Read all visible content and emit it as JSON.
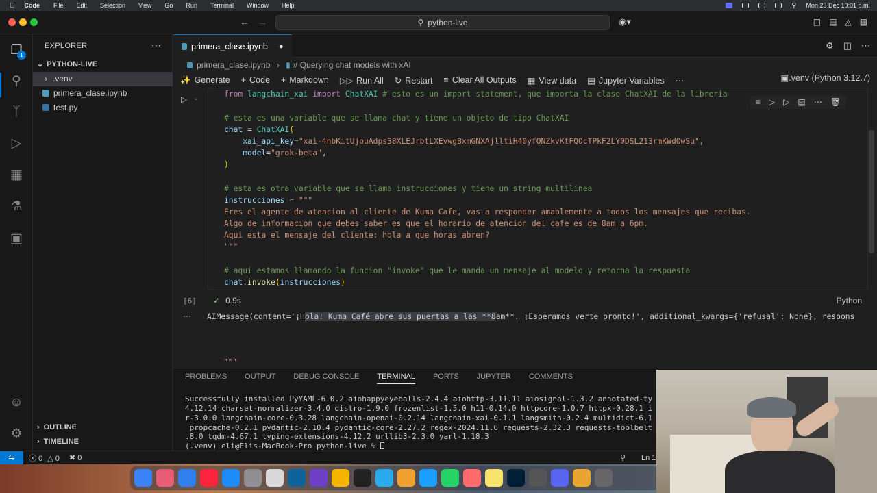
{
  "menubar": {
    "app": "Code",
    "items": [
      "File",
      "Edit",
      "Selection",
      "View",
      "Go",
      "Run",
      "Terminal",
      "Window",
      "Help"
    ],
    "datetime": "Mon 23 Dec  10:01 p.m."
  },
  "titlebar": {
    "search": "python-live"
  },
  "explorer": {
    "title": "EXPLORER",
    "root": "PYTHON-LIVE",
    "items": [
      ".venv",
      "primera_clase.ipynb",
      "test.py"
    ],
    "outline": "OUTLINE",
    "timeline": "TIMELINE"
  },
  "activitybar": {
    "explorer_badge": "1"
  },
  "editor": {
    "tab": "primera_clase.ipynb",
    "breadcrumb": {
      "file": "primera_clase.ipynb",
      "section": "# Querying chat models with xAI"
    },
    "toolbar": {
      "generate": "Generate",
      "code": "Code",
      "markdown": "Markdown",
      "run_all": "Run All",
      "restart": "Restart",
      "clear": "Clear All Outputs",
      "view_data": "View data",
      "jupyter_vars": "Jupyter Variables",
      "kernel": ".venv (Python 3.12.7)"
    },
    "cell": {
      "exec_count": "[6]",
      "exec_time": "0.9s",
      "language": "Python",
      "code": {
        "l1a": "from",
        "l1b": " langchain_xai ",
        "l1c": "import",
        "l1d": " ChatXAI",
        "l1e": " # esto es un import statement, que importa la clase ChatXAI de la libreria",
        "l2": "# esta es una variable que se llama chat y tiene un objeto de tipo ChatXAI",
        "l3a": "chat",
        "l3b": " = ",
        "l3c": "ChatXAI",
        "l3d": "(",
        "l4a": "    xai_api_key",
        "l4b": "=",
        "l4c": "\"xai-4nbKitUjouAdps38XLEJrbtLXEvwgBxmGNXAjlltiH40yfONZkvKtFQOcTPkF2LY0DSL213rmKWdOwSu\"",
        "l4d": ",",
        "l5a": "    model",
        "l5b": "=",
        "l5c": "\"grok-beta\"",
        "l5d": ",",
        "l6": ")",
        "l7": "# esta es otra variable que se llama instrucciones y tiene un string multilinea",
        "l8a": "instrucciones",
        "l8b": " = ",
        "l8c": "\"\"\"",
        "l9": "Eres el agente de atencion al cliente de Kuma Cafe, vas a responder amablemente a todos los mensajes que recibas.",
        "l10": "Algo de informacion que debes saber es que el horario de atencion del cafe es de 8am a 6pm.",
        "l11": "Aqui esta el mensaje del cliente: hola a que horas abren?",
        "l12": "\"\"\"",
        "l13": "# aqui estamos llamando la funcion \"invoke\" que le manda un mensaje al modelo y retorna la respuesta",
        "l14a": "chat",
        "l14b": ".",
        "l14c": "invoke",
        "l14d": "(",
        "l14e": "instrucciones",
        "l14f": ")"
      }
    },
    "output": {
      "pre": "AIMessage(content='¡H",
      "highlight": "ola! Kuma Café abre sus puertas a las **8",
      "post": "am**. ¡Esperamos verte pronto!', additional_kwargs={'refusal': None}, respons",
      "next": "\"\"\""
    }
  },
  "panel": {
    "tabs": [
      "PROBLEMS",
      "OUTPUT",
      "DEBUG CONSOLE",
      "TERMINAL",
      "PORTS",
      "JUPYTER",
      "COMMENTS"
    ],
    "active_tab": "TERMINAL",
    "terminal": [
      "Successfully installed PyYAML-6.0.2 aiohappyeyeballs-2.4.4 aiohttp-3.11.11 aiosignal-1.3.2 annotated-ty",
      "4.12.14 charset-normalizer-3.4.0 distro-1.9.0 frozenlist-1.5.0 h11-0.14.0 httpcore-1.0.7 httpx-0.28.1 i",
      "r-3.0.0 langchain-core-0.3.28 langchain-openai-0.2.14 langchain-xai-0.1.1 langsmith-0.2.4 multidict-6.1",
      " propcache-0.2.1 pydantic-2.10.4 pydantic-core-2.27.2 regex-2024.11.6 requests-2.32.3 requests-toolbelt",
      ".8.0 tqdm-4.67.1 typing-extensions-4.12.2 urllib3-2.3.0 yarl-1.18.3",
      "(.venv) eli@Elis-MacBook-Pro python-live % "
    ]
  },
  "statusbar": {
    "errors": "0",
    "warnings": "0",
    "ports": "0",
    "position": "Ln 1"
  }
}
